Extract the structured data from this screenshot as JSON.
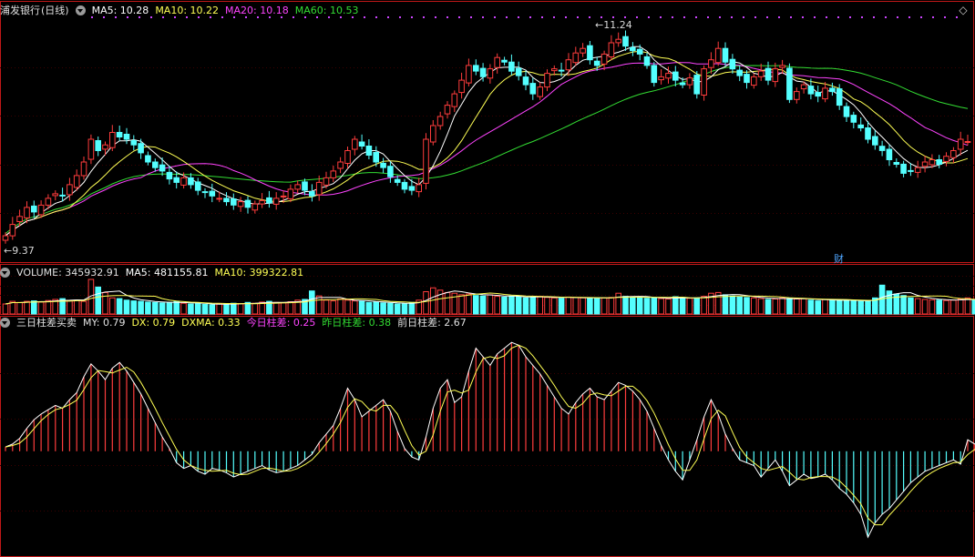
{
  "colors": {
    "up": "#ff3d3d",
    "down": "#54ffff",
    "ma5": "#ffffff",
    "ma10": "#ffff55",
    "ma20": "#ff44ff",
    "ma60": "#33dd33",
    "panel_border": "#c01818",
    "grid": "#3a0000"
  },
  "price_panel": {
    "stock_name": "浦发银行",
    "period": "(日线)",
    "ma5": "MA5: 10.28",
    "ma10": "MA10: 10.22",
    "ma20": "MA20: 10.18",
    "ma60": "MA60: 10.53",
    "high_label": "11.24",
    "low_label": "9.37",
    "badge": "财",
    "control_icon": "diamond-icon"
  },
  "volume_panel": {
    "title": "VOLUME: 345932.91",
    "ma5": "MA5: 481155.81",
    "ma10": "MA10: 399322.81"
  },
  "indicator_panel": {
    "title": "三日柱差买卖",
    "my": "MY: 0.79",
    "dx": "DX: 0.79",
    "dxma": "DXMA: 0.33",
    "today_label": "今日柱差",
    "today_value": ": 0.25",
    "yesterday_label": "昨日柱差",
    "yesterday_value": ": 0.38",
    "before": "前日柱差: 2.67"
  },
  "chart_data": {
    "type": "candlestick",
    "ylim": [
      9.25,
      11.35
    ],
    "closes": [
      9.45,
      9.55,
      9.62,
      9.7,
      9.66,
      9.72,
      9.78,
      9.82,
      9.8,
      9.9,
      9.98,
      10.1,
      10.3,
      10.2,
      10.25,
      10.36,
      10.32,
      10.3,
      10.25,
      10.18,
      10.1,
      10.05,
      10.02,
      9.95,
      9.92,
      9.96,
      9.9,
      9.85,
      9.83,
      9.8,
      9.78,
      9.75,
      9.72,
      9.75,
      9.7,
      9.73,
      9.76,
      9.74,
      9.78,
      9.8,
      9.86,
      9.9,
      9.85,
      9.8,
      9.92,
      9.96,
      10.02,
      10.1,
      10.2,
      10.3,
      10.24,
      10.16,
      10.1,
      10.05,
      9.97,
      9.92,
      9.86,
      9.85,
      9.9,
      10.3,
      10.42,
      10.5,
      10.6,
      10.7,
      10.82,
      10.95,
      10.9,
      10.85,
      10.92,
      11.02,
      10.98,
      10.9,
      10.86,
      10.78,
      10.7,
      10.76,
      10.88,
      10.92,
      10.9,
      11.0,
      11.06,
      11.1,
      11.0,
      10.95,
      11.05,
      11.15,
      11.18,
      11.12,
      11.08,
      11.05,
      10.95,
      10.8,
      10.85,
      10.88,
      10.82,
      10.78,
      10.84,
      10.7,
      10.92,
      11.0,
      11.1,
      10.98,
      10.92,
      10.86,
      10.8,
      10.85,
      10.9,
      10.82,
      10.92,
      10.95,
      10.65,
      10.72,
      10.78,
      10.7,
      10.68,
      10.75,
      10.72,
      10.6,
      10.5,
      10.45,
      10.4,
      10.3,
      10.25,
      10.2,
      10.12,
      10.08,
      10.0,
      10.02,
      10.05,
      10.1,
      10.12,
      10.08,
      10.15,
      10.2,
      10.3,
      10.28
    ],
    "volumes": [
      260,
      330,
      300,
      330,
      340,
      310,
      350,
      380,
      400,
      350,
      360,
      330,
      900,
      700,
      560,
      420,
      400,
      360,
      340,
      330,
      310,
      300,
      290,
      300,
      320,
      280,
      260,
      270,
      250,
      240,
      260,
      260,
      280,
      270,
      300,
      280,
      310,
      330,
      300,
      290,
      320,
      360,
      380,
      600,
      470,
      360,
      340,
      390,
      360,
      340,
      330,
      300,
      310,
      290,
      280,
      260,
      270,
      300,
      360,
      580,
      680,
      620,
      560,
      540,
      500,
      520,
      480,
      470,
      500,
      460,
      440,
      460,
      450,
      420,
      440,
      460,
      430,
      420,
      410,
      440,
      430,
      420,
      410,
      400,
      420,
      430,
      540,
      460,
      440,
      430,
      410,
      420,
      400,
      390,
      450,
      430,
      410,
      420,
      460,
      540,
      560,
      500,
      470,
      440,
      430,
      420,
      400,
      380,
      390,
      420,
      400,
      390,
      400,
      360,
      340,
      380,
      360,
      350,
      360,
      340,
      330,
      340,
      420,
      750,
      600,
      520,
      480,
      420,
      400,
      380,
      370,
      360,
      350,
      360,
      390,
      420,
      360,
      346
    ],
    "dx": [
      0.3,
      0.5,
      0.9,
      1.6,
      2.2,
      2.6,
      2.9,
      3.2,
      3.0,
      3.6,
      4.1,
      5.2,
      6.1,
      5.6,
      5.0,
      5.8,
      6.2,
      5.6,
      4.8,
      4.0,
      3.0,
      2.0,
      1.0,
      0.2,
      -0.8,
      -1.2,
      -1.0,
      -1.4,
      -1.6,
      -1.2,
      -1.3,
      -1.5,
      -1.8,
      -1.6,
      -1.4,
      -1.2,
      -1.0,
      -1.3,
      -1.5,
      -1.4,
      -1.2,
      -1.0,
      -0.6,
      -0.2,
      0.6,
      1.2,
      1.8,
      3.0,
      4.4,
      3.6,
      2.4,
      2.8,
      3.2,
      3.6,
      2.8,
      1.4,
      0.2,
      -0.4,
      -0.6,
      1.0,
      3.0,
      4.4,
      5.0,
      3.4,
      3.8,
      5.6,
      7.2,
      6.6,
      6.0,
      6.8,
      7.2,
      7.6,
      7.4,
      6.6,
      6.0,
      5.4,
      4.6,
      3.8,
      3.0,
      2.6,
      3.4,
      4.0,
      4.4,
      3.8,
      3.6,
      4.2,
      4.8,
      4.6,
      4.2,
      3.6,
      2.8,
      1.6,
      0.4,
      -0.6,
      -1.4,
      -2.0,
      -0.6,
      0.8,
      2.4,
      3.6,
      2.6,
      1.2,
      0.2,
      -0.6,
      -0.8,
      -1.0,
      -1.8,
      -1.2,
      -0.6,
      -1.4,
      -2.4,
      -2.0,
      -1.6,
      -1.9,
      -1.8,
      -1.6,
      -2.0,
      -2.6,
      -3.0,
      -3.6,
      -4.4,
      -6.0,
      -5.0,
      -4.4,
      -4.0,
      -3.4,
      -2.8,
      -2.2,
      -1.8,
      -1.4,
      -1.2,
      -1.0,
      -0.8,
      -0.6,
      -0.9,
      0.8,
      0.5,
      0.3
    ]
  }
}
